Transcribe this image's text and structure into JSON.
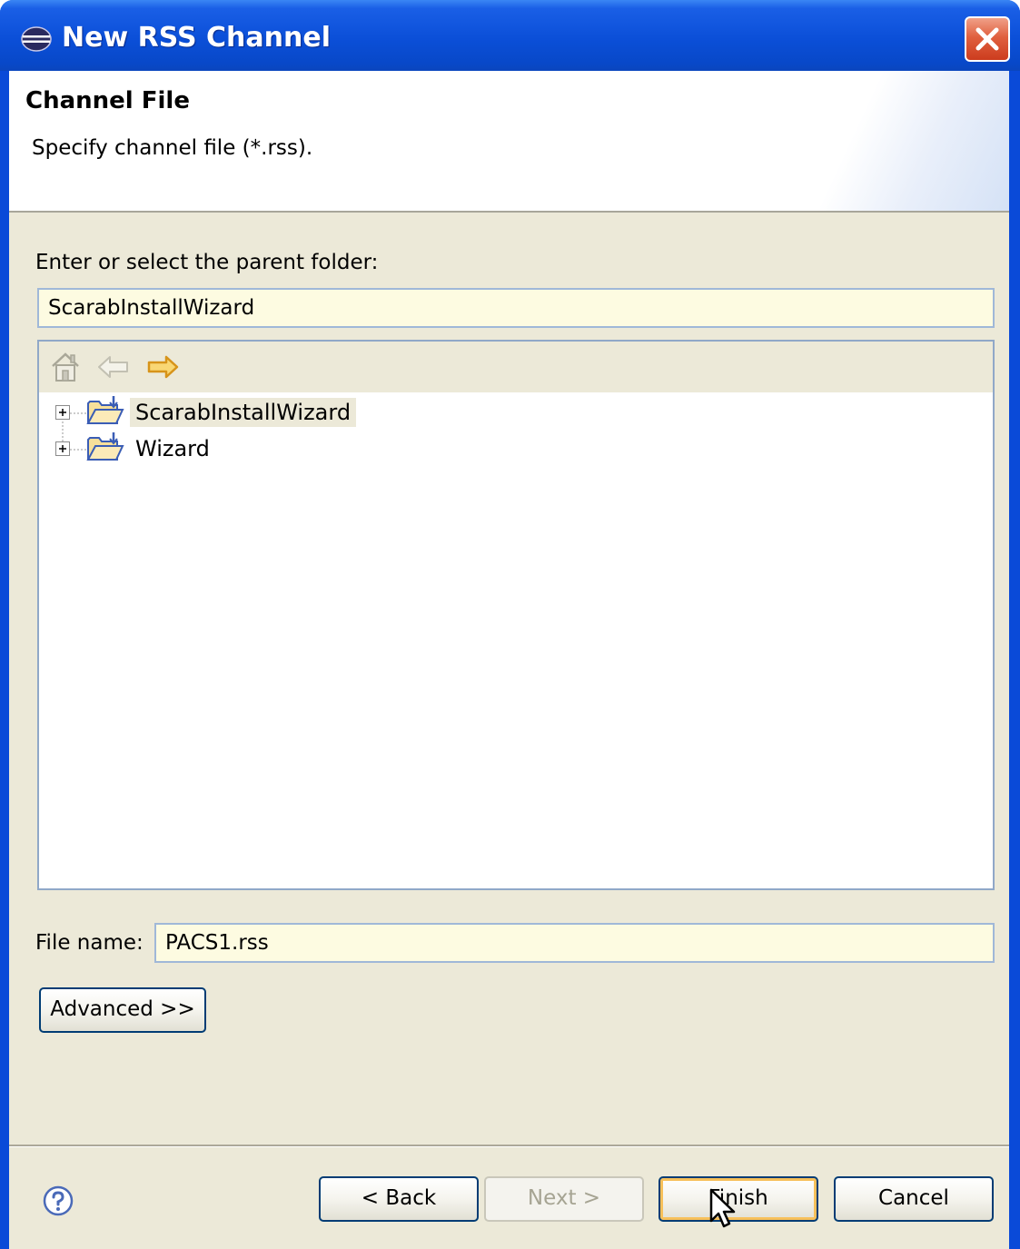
{
  "window": {
    "title": "New RSS Channel"
  },
  "banner": {
    "title": "Channel File",
    "description": "Specify channel file (*.rss)."
  },
  "folder_select": {
    "label": "Enter or select the parent folder:",
    "value": "ScarabInstallWizard"
  },
  "tree": {
    "items": [
      {
        "label": "ScarabInstallWizard",
        "selected": true
      },
      {
        "label": "Wizard",
        "selected": false
      }
    ]
  },
  "file_name": {
    "label": "File name:",
    "value": "PACS1.rss"
  },
  "buttons": {
    "advanced": "Advanced >>",
    "back": "< Back",
    "next": "Next >",
    "finish": "Finish",
    "cancel": "Cancel"
  },
  "colors": {
    "title_bar": "#0b4fd8",
    "dialog_bg": "#ece9d8",
    "field_bg": "#fdfbe1",
    "close_button": "#e0603f"
  },
  "icons": {
    "title": "eclipse-icon",
    "close": "close-icon",
    "home": "home-icon",
    "back": "arrow-left-icon",
    "forward": "arrow-right-icon",
    "folder": "open-folder-icon",
    "help": "help-icon"
  }
}
